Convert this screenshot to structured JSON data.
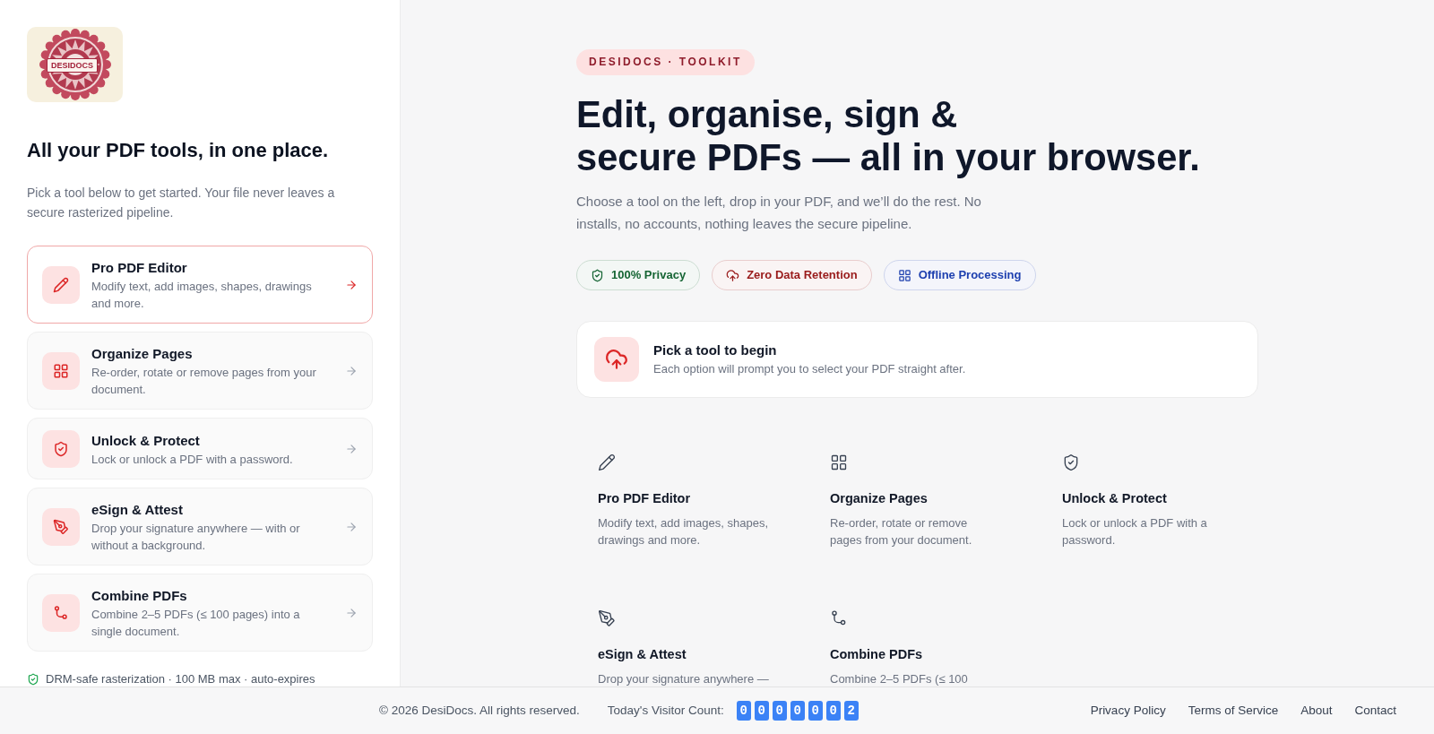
{
  "sidebar": {
    "logo": {
      "text": "DESIDOCS"
    },
    "heading": "All your PDF tools, in one place.",
    "intro": "Pick a tool below to get started. Your file never leaves a secure rasterized pipeline.",
    "tools": [
      {
        "title": "Pro PDF Editor",
        "description": "Modify text, add images, shapes, drawings and more.",
        "selected": true
      },
      {
        "title": "Organize Pages",
        "description": "Re-order, rotate or remove pages from your document.",
        "selected": false
      },
      {
        "title": "Unlock & Protect",
        "description": "Lock or unlock a PDF with a password.",
        "selected": false
      },
      {
        "title": "eSign & Attest",
        "description": "Drop your signature anywhere — with or without a background.",
        "selected": false
      },
      {
        "title": "Combine PDFs",
        "description": "Combine 2–5 PDFs (≤ 100 pages) into a single document.",
        "selected": false
      }
    ],
    "note": "DRM-safe rasterization · 100 MB max · auto-expires"
  },
  "main": {
    "eyebrow": "DESIDOCS · TOOLKIT",
    "heading": "Edit, organise, sign &\nsecure PDFs — all in your browser.",
    "lead": "Choose a tool on the left, drop in your PDF, and we’ll do the rest. No installs, no accounts, nothing leaves the secure pipeline.",
    "badges": [
      {
        "label": "100% Privacy",
        "color": "#166534"
      },
      {
        "label": "Zero Data Retention",
        "color": "#991b1b"
      },
      {
        "label": "Offline Processing",
        "color": "#1e40af"
      }
    ],
    "prompt": {
      "title": "Pick a tool to begin",
      "description": "Each option will prompt you to select your PDF straight after."
    },
    "tools": [
      {
        "title": "Pro PDF Editor",
        "description": "Modify text, add images, shapes, drawings and more."
      },
      {
        "title": "Organize Pages",
        "description": "Re-order, rotate or remove pages from your document."
      },
      {
        "title": "Unlock & Protect",
        "description": "Lock or unlock a PDF with a password."
      },
      {
        "title": "eSign & Attest",
        "description": "Drop your signature anywhere —"
      },
      {
        "title": "Combine PDFs",
        "description": "Combine 2–5 PDFs (≤ 100"
      }
    ]
  },
  "footer": {
    "copyright": "© 2026 DesiDocs. All rights reserved.",
    "visitor_label": "Today's Visitor Count:",
    "visitor_digits": [
      "0",
      "0",
      "0",
      "0",
      "0",
      "0",
      "2"
    ],
    "links": [
      "Privacy Policy",
      "Terms of Service",
      "About",
      "Contact"
    ]
  }
}
